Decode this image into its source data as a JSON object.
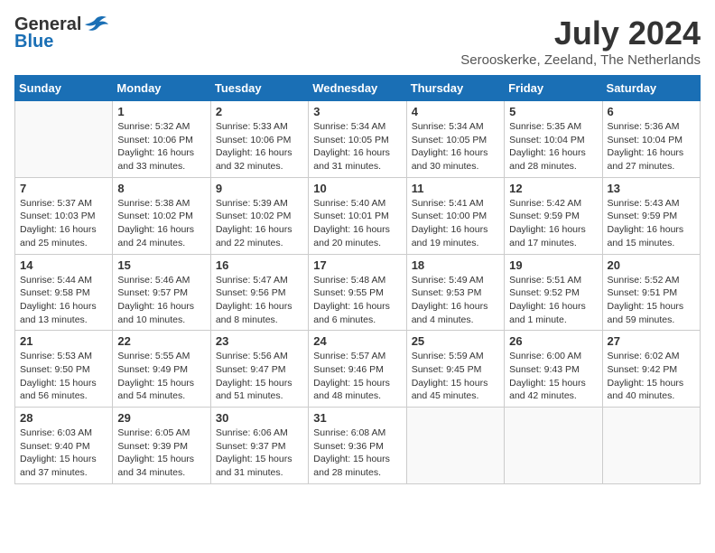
{
  "header": {
    "logo_general": "General",
    "logo_blue": "Blue",
    "month_year": "July 2024",
    "location": "Serooskerke, Zeeland, The Netherlands"
  },
  "weekdays": [
    "Sunday",
    "Monday",
    "Tuesday",
    "Wednesday",
    "Thursday",
    "Friday",
    "Saturday"
  ],
  "weeks": [
    [
      {
        "day": "",
        "info": ""
      },
      {
        "day": "1",
        "info": "Sunrise: 5:32 AM\nSunset: 10:06 PM\nDaylight: 16 hours\nand 33 minutes."
      },
      {
        "day": "2",
        "info": "Sunrise: 5:33 AM\nSunset: 10:06 PM\nDaylight: 16 hours\nand 32 minutes."
      },
      {
        "day": "3",
        "info": "Sunrise: 5:34 AM\nSunset: 10:05 PM\nDaylight: 16 hours\nand 31 minutes."
      },
      {
        "day": "4",
        "info": "Sunrise: 5:34 AM\nSunset: 10:05 PM\nDaylight: 16 hours\nand 30 minutes."
      },
      {
        "day": "5",
        "info": "Sunrise: 5:35 AM\nSunset: 10:04 PM\nDaylight: 16 hours\nand 28 minutes."
      },
      {
        "day": "6",
        "info": "Sunrise: 5:36 AM\nSunset: 10:04 PM\nDaylight: 16 hours\nand 27 minutes."
      }
    ],
    [
      {
        "day": "7",
        "info": "Sunrise: 5:37 AM\nSunset: 10:03 PM\nDaylight: 16 hours\nand 25 minutes."
      },
      {
        "day": "8",
        "info": "Sunrise: 5:38 AM\nSunset: 10:02 PM\nDaylight: 16 hours\nand 24 minutes."
      },
      {
        "day": "9",
        "info": "Sunrise: 5:39 AM\nSunset: 10:02 PM\nDaylight: 16 hours\nand 22 minutes."
      },
      {
        "day": "10",
        "info": "Sunrise: 5:40 AM\nSunset: 10:01 PM\nDaylight: 16 hours\nand 20 minutes."
      },
      {
        "day": "11",
        "info": "Sunrise: 5:41 AM\nSunset: 10:00 PM\nDaylight: 16 hours\nand 19 minutes."
      },
      {
        "day": "12",
        "info": "Sunrise: 5:42 AM\nSunset: 9:59 PM\nDaylight: 16 hours\nand 17 minutes."
      },
      {
        "day": "13",
        "info": "Sunrise: 5:43 AM\nSunset: 9:59 PM\nDaylight: 16 hours\nand 15 minutes."
      }
    ],
    [
      {
        "day": "14",
        "info": "Sunrise: 5:44 AM\nSunset: 9:58 PM\nDaylight: 16 hours\nand 13 minutes."
      },
      {
        "day": "15",
        "info": "Sunrise: 5:46 AM\nSunset: 9:57 PM\nDaylight: 16 hours\nand 10 minutes."
      },
      {
        "day": "16",
        "info": "Sunrise: 5:47 AM\nSunset: 9:56 PM\nDaylight: 16 hours\nand 8 minutes."
      },
      {
        "day": "17",
        "info": "Sunrise: 5:48 AM\nSunset: 9:55 PM\nDaylight: 16 hours\nand 6 minutes."
      },
      {
        "day": "18",
        "info": "Sunrise: 5:49 AM\nSunset: 9:53 PM\nDaylight: 16 hours\nand 4 minutes."
      },
      {
        "day": "19",
        "info": "Sunrise: 5:51 AM\nSunset: 9:52 PM\nDaylight: 16 hours\nand 1 minute."
      },
      {
        "day": "20",
        "info": "Sunrise: 5:52 AM\nSunset: 9:51 PM\nDaylight: 15 hours\nand 59 minutes."
      }
    ],
    [
      {
        "day": "21",
        "info": "Sunrise: 5:53 AM\nSunset: 9:50 PM\nDaylight: 15 hours\nand 56 minutes."
      },
      {
        "day": "22",
        "info": "Sunrise: 5:55 AM\nSunset: 9:49 PM\nDaylight: 15 hours\nand 54 minutes."
      },
      {
        "day": "23",
        "info": "Sunrise: 5:56 AM\nSunset: 9:47 PM\nDaylight: 15 hours\nand 51 minutes."
      },
      {
        "day": "24",
        "info": "Sunrise: 5:57 AM\nSunset: 9:46 PM\nDaylight: 15 hours\nand 48 minutes."
      },
      {
        "day": "25",
        "info": "Sunrise: 5:59 AM\nSunset: 9:45 PM\nDaylight: 15 hours\nand 45 minutes."
      },
      {
        "day": "26",
        "info": "Sunrise: 6:00 AM\nSunset: 9:43 PM\nDaylight: 15 hours\nand 42 minutes."
      },
      {
        "day": "27",
        "info": "Sunrise: 6:02 AM\nSunset: 9:42 PM\nDaylight: 15 hours\nand 40 minutes."
      }
    ],
    [
      {
        "day": "28",
        "info": "Sunrise: 6:03 AM\nSunset: 9:40 PM\nDaylight: 15 hours\nand 37 minutes."
      },
      {
        "day": "29",
        "info": "Sunrise: 6:05 AM\nSunset: 9:39 PM\nDaylight: 15 hours\nand 34 minutes."
      },
      {
        "day": "30",
        "info": "Sunrise: 6:06 AM\nSunset: 9:37 PM\nDaylight: 15 hours\nand 31 minutes."
      },
      {
        "day": "31",
        "info": "Sunrise: 6:08 AM\nSunset: 9:36 PM\nDaylight: 15 hours\nand 28 minutes."
      },
      {
        "day": "",
        "info": ""
      },
      {
        "day": "",
        "info": ""
      },
      {
        "day": "",
        "info": ""
      }
    ]
  ]
}
